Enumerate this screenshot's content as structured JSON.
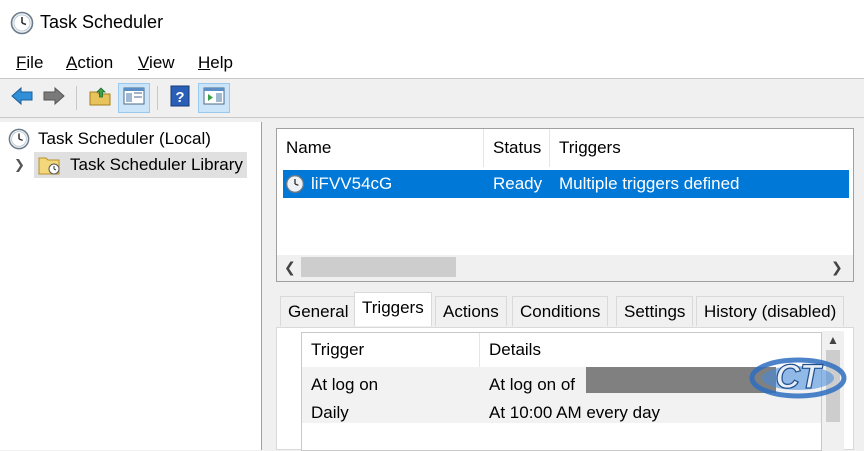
{
  "window": {
    "title": "Task Scheduler",
    "icon": "clock-icon"
  },
  "menu": [
    {
      "mnemonic": "F",
      "rest": "ile"
    },
    {
      "mnemonic": "A",
      "rest": "ction"
    },
    {
      "mnemonic": "V",
      "rest": "iew"
    },
    {
      "mnemonic": "H",
      "rest": "elp"
    }
  ],
  "toolbar": {
    "buttons": [
      "back-icon",
      "forward-icon",
      "up-folder-icon",
      "show-hide-console-tree-icon",
      "help-icon",
      "show-hide-action-pane-icon"
    ]
  },
  "tree": {
    "root": "Task Scheduler (Local)",
    "library": "Task Scheduler Library"
  },
  "task_list": {
    "columns": [
      "Name",
      "Status",
      "Triggers"
    ],
    "rows": [
      {
        "name": "liFVV54cG",
        "status": "Ready",
        "triggers": "Multiple triggers defined"
      }
    ]
  },
  "tabs": [
    "General",
    "Triggers",
    "Actions",
    "Conditions",
    "Settings",
    "History (disabled)"
  ],
  "active_tab": "Triggers",
  "trigger_table": {
    "columns": [
      "Trigger",
      "Details"
    ],
    "rows": [
      {
        "trigger": "At log on",
        "details": "At log on of"
      },
      {
        "trigger": "Daily",
        "details": "At 10:00 AM every day"
      }
    ]
  },
  "colors": {
    "selection": "#0078d7",
    "pressed": "#cce4f7"
  }
}
